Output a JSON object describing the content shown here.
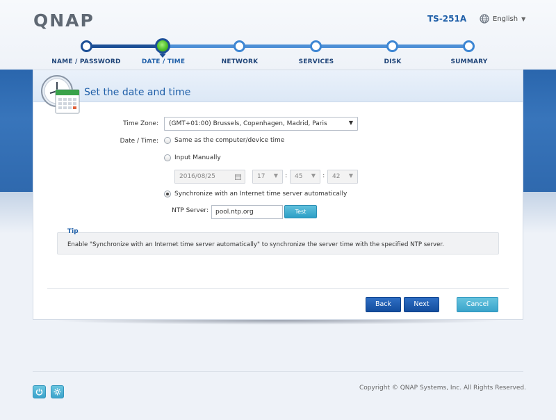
{
  "header": {
    "logo": "QNAP",
    "model": "TS-251A",
    "language": "English"
  },
  "steps": [
    {
      "label": "NAME / PASSWORD",
      "state": "done"
    },
    {
      "label": "DATE / TIME",
      "state": "active"
    },
    {
      "label": "NETWORK",
      "state": "pending"
    },
    {
      "label": "SERVICES",
      "state": "pending"
    },
    {
      "label": "DISK",
      "state": "pending"
    },
    {
      "label": "SUMMARY",
      "state": "pending"
    }
  ],
  "panel": {
    "title": "Set the date and time"
  },
  "form": {
    "timezone_label": "Time Zone:",
    "timezone_value": "(GMT+01:00) Brussels, Copenhagen, Madrid, Paris",
    "datetime_label": "Date / Time:",
    "option_same": "Same as the computer/device time",
    "option_manual": "Input Manually",
    "manual_date": "2016/08/25",
    "manual_hour": "17",
    "manual_minute": "45",
    "manual_second": "42",
    "option_ntp": "Synchronize with an Internet time server automatically",
    "selected_option": "ntp",
    "ntp_label": "NTP Server:",
    "ntp_value": "pool.ntp.org",
    "test_button": "Test"
  },
  "tip": {
    "title": "Tip",
    "text": "Enable \"Synchronize with an Internet time server automatically\" to synchronize the server time with the specified NTP server."
  },
  "buttons": {
    "back": "Back",
    "next": "Next",
    "cancel": "Cancel"
  },
  "footer": {
    "copyright": "Copyright © QNAP Systems, Inc. All Rights Reserved."
  },
  "colors": {
    "accent": "#1f5fa8",
    "primary_button": "#134d9e",
    "secondary_button": "#3aa4cb",
    "band": "#3875bb"
  }
}
